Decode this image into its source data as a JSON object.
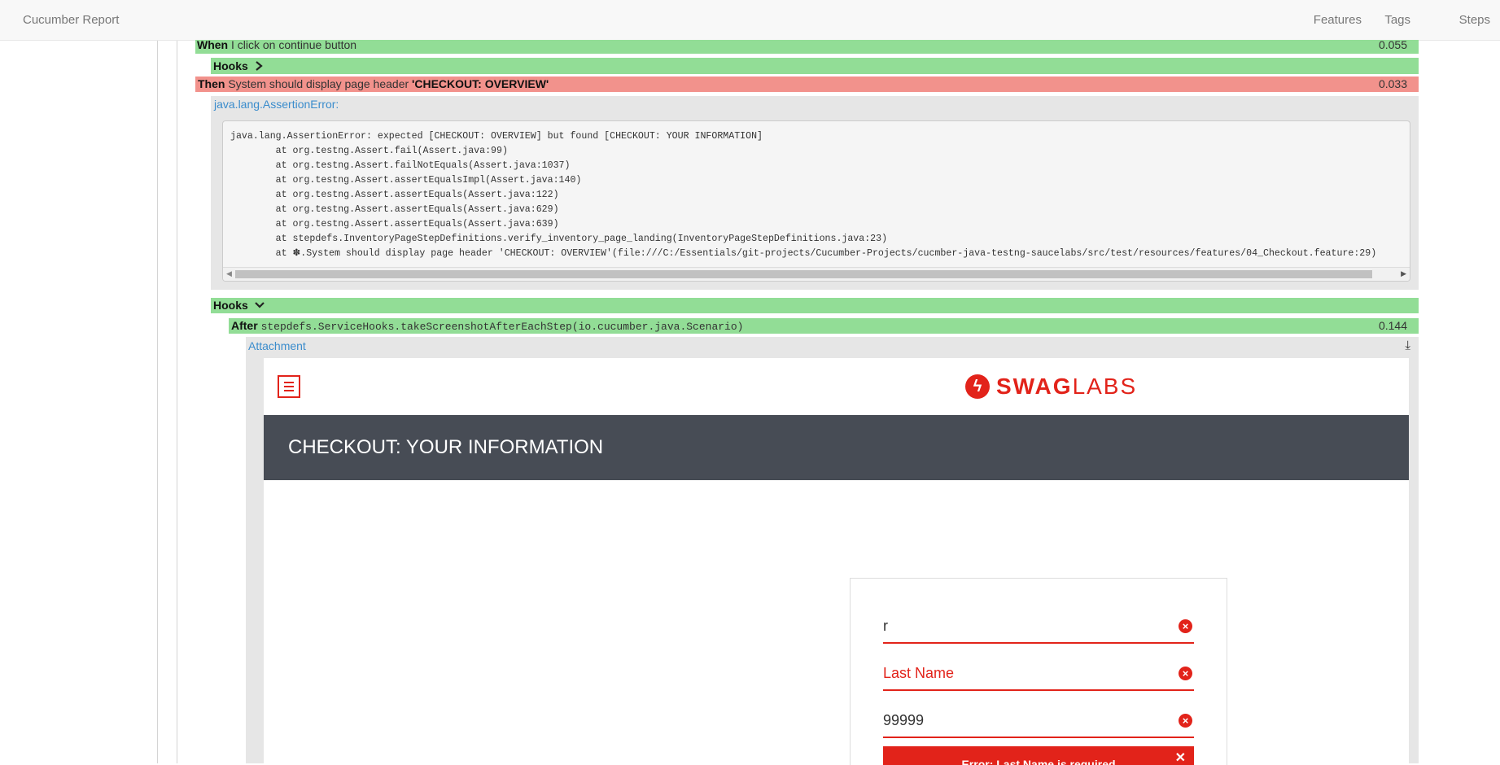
{
  "topbar": {
    "title": "Cucumber Report",
    "nav": [
      "Features",
      "Tags",
      "Steps"
    ]
  },
  "steps": {
    "when": {
      "keyword": "When",
      "text": "I click on continue button",
      "duration": "0.055"
    },
    "hooks_collapsed": {
      "label": "Hooks",
      "chevron": "chevron-right-icon"
    },
    "then": {
      "keyword": "Then",
      "text": "System should display page header",
      "arg": "'CHECKOUT: OVERVIEW'",
      "duration": "0.033",
      "status": "failed"
    },
    "hooks_expanded": {
      "label": "Hooks",
      "chevron": "chevron-down-icon"
    },
    "after": {
      "keyword": "After",
      "text": "stepdefs.ServiceHooks.takeScreenshotAfterEachStep(io.cucumber.java.Scenario)",
      "duration": "0.144"
    }
  },
  "error": {
    "link": "java.lang.AssertionError:",
    "stacktrace": [
      "java.lang.AssertionError: expected [CHECKOUT: OVERVIEW] but found [CHECKOUT: YOUR INFORMATION]",
      "\tat org.testng.Assert.fail(Assert.java:99)",
      "\tat org.testng.Assert.failNotEquals(Assert.java:1037)",
      "\tat org.testng.Assert.assertEqualsImpl(Assert.java:140)",
      "\tat org.testng.Assert.assertEquals(Assert.java:122)",
      "\tat org.testng.Assert.assertEquals(Assert.java:629)",
      "\tat org.testng.Assert.assertEquals(Assert.java:639)",
      "\tat stepdefs.InventoryPageStepDefinitions.verify_inventory_page_landing(InventoryPageStepDefinitions.java:23)",
      "\tat ✽.System should display page header 'CHECKOUT: OVERVIEW'(file:///C:/Essentials/git-projects/Cucumber-Projects/cucmber-java-testng-saucelabs/src/test/resources/features/04_Checkout.feature:29)"
    ]
  },
  "attachment": {
    "label": "Attachment",
    "download_icon": "download-icon",
    "screenshot": {
      "logo_bold": "SWAG",
      "logo_light": "LABS",
      "header": "CHECKOUT: YOUR INFORMATION",
      "fields": [
        {
          "value": "r",
          "state": "error"
        },
        {
          "value": "Last Name",
          "state": "error-placeholder"
        },
        {
          "value": "99999",
          "state": "error"
        }
      ],
      "error_message": "Error: Last Name is required"
    }
  },
  "colors": {
    "passed": "#92dd96",
    "failed": "#f2928c",
    "link": "#3a8ccc",
    "brand_red": "#e2231a",
    "header_band": "#474c55"
  }
}
